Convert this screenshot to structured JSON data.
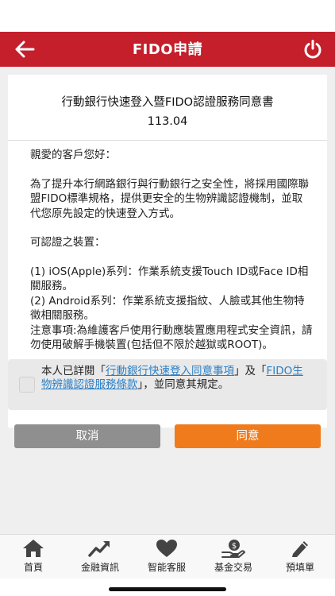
{
  "header": {
    "title": "FIDO申請",
    "back_icon": "arrow-left-icon",
    "power_icon": "power-icon",
    "bg_color": "#c41f2b"
  },
  "document": {
    "title": "行動銀行快速登入暨FIDO認證服務同意書",
    "version": "113.04",
    "greeting": "親愛的客戶您好：",
    "para1": "為了提升本行網路銀行與行動銀行之安全性，將採用國際聯盟FIDO標準規格，提供更安全的生物辨識認證機制，並取代您原先設定的快速登入方式。",
    "devices_heading": "可認證之裝置：",
    "device_ios": "(1) iOS(Apple)系列：作業系統支援Touch ID或Face ID相關服務。",
    "device_android": "(2) Android系列：作業系統支援指紋、人臉或其他生物特徵相關服務。",
    "notice": "注意事項:為維護客戶使用行動應裝置應用程式安全資訊，請勿使用破解手機裝置(包括但不限於越獄或ROOT)。"
  },
  "agreement": {
    "prefix": "本人已詳閱「",
    "link1": "行動銀行快速登入同意事項",
    "mid": "」及「",
    "link2": "FIDO生物辨識認證服務條款",
    "suffix": "」，並同意其規定。",
    "checked": false
  },
  "buttons": {
    "cancel": "取消",
    "agree": "同意",
    "cancel_color": "#8f8f8f",
    "agree_color": "#f07b1c"
  },
  "tabbar": {
    "items": [
      {
        "label": "首頁",
        "icon": "home-icon"
      },
      {
        "label": "金融資訊",
        "icon": "trend-chart-icon"
      },
      {
        "label": "智能客服",
        "icon": "heart-icon"
      },
      {
        "label": "基金交易",
        "icon": "money-hand-icon"
      },
      {
        "label": "預填單",
        "icon": "pencil-icon"
      }
    ]
  }
}
